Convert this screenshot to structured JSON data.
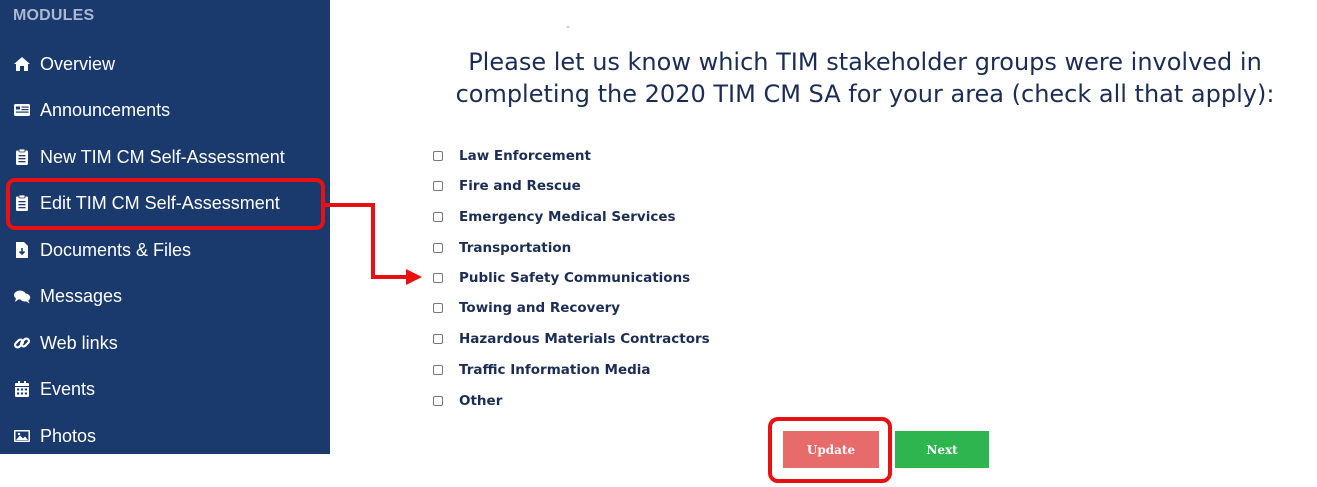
{
  "sidebar": {
    "heading": "MODULES",
    "items": [
      {
        "label": "Overview",
        "icon": "home-icon"
      },
      {
        "label": "Announcements",
        "icon": "newspaper-icon"
      },
      {
        "label": "New TIM CM Self-Assessment",
        "icon": "clipboard-icon"
      },
      {
        "label": "Edit TIM CM Self-Assessment",
        "icon": "clipboard-icon"
      },
      {
        "label": "Documents & Files",
        "icon": "file-download-icon"
      },
      {
        "label": "Messages",
        "icon": "comments-icon"
      },
      {
        "label": "Web links",
        "icon": "link-icon"
      },
      {
        "label": "Events",
        "icon": "calendar-icon"
      },
      {
        "label": "Photos",
        "icon": "image-icon"
      }
    ]
  },
  "main": {
    "dash": "-",
    "title_line1": "Please let us know which TIM stakeholder groups were involved in",
    "title_line2": "completing the 2020 TIM CM SA for your area (check all that apply):",
    "options": [
      "Law Enforcement",
      "Fire and Rescue",
      "Emergency Medical Services",
      "Transportation",
      "Public Safety Communications",
      "Towing and Recovery",
      "Hazardous Materials Contractors",
      "Traffic Information Media",
      "Other"
    ],
    "update_label": "Update",
    "next_label": "Next"
  },
  "colors": {
    "sidebar_bg": "#1a3a6e",
    "highlight": "#e81010",
    "update_bg": "#e86b6b",
    "next_bg": "#2fb550",
    "title_text": "#1b2d55"
  }
}
